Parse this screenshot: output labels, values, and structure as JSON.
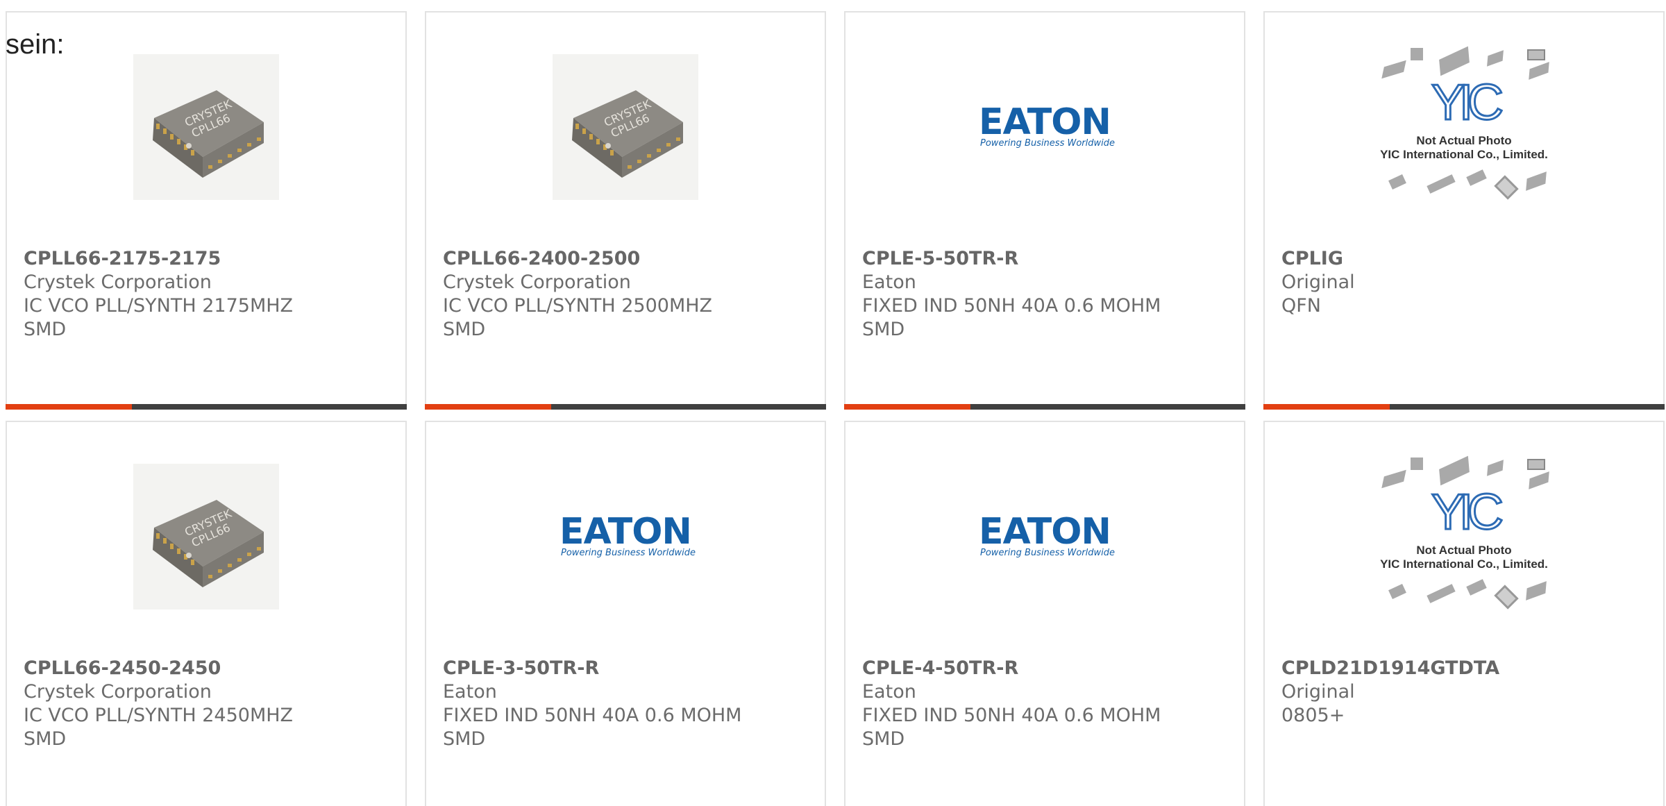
{
  "heading": "sein:",
  "colors": {
    "accent": "#e23f12",
    "bar": "#404040",
    "border": "#e2e2e2",
    "eaton_blue": "#1560a8"
  },
  "products": [
    {
      "part_number": "CPLL66-2175-2175",
      "manufacturer": "Crystek Corporation",
      "description": "IC VCO PLL/SYNTH 2175MHZ",
      "package": "SMD",
      "image": "crystek-chip",
      "chip_text": [
        "CRYSTEK",
        "CPLL66"
      ]
    },
    {
      "part_number": "CPLL66-2400-2500",
      "manufacturer": "Crystek Corporation",
      "description": "IC VCO PLL/SYNTH 2500MHZ",
      "package": "SMD",
      "image": "crystek-chip",
      "chip_text": [
        "CRYSTEK",
        "CPLL66"
      ]
    },
    {
      "part_number": "CPLE-5-50TR-R",
      "manufacturer": "Eaton",
      "description": "FIXED IND 50NH 40A 0.6 MOHM",
      "package": "SMD",
      "image": "eaton-logo",
      "logo_text": "EATON",
      "logo_tagline": "Powering Business Worldwide"
    },
    {
      "part_number": "CPLIG",
      "manufacturer": "Original",
      "description": "QFN",
      "package": "",
      "image": "yic-placeholder",
      "logo_text": "YIC",
      "caption_1": "Not Actual Photo",
      "caption_2": "YIC International Co., Limited."
    },
    {
      "part_number": "CPLL66-2450-2450",
      "manufacturer": "Crystek Corporation",
      "description": "IC VCO PLL/SYNTH 2450MHZ",
      "package": "SMD",
      "image": "crystek-chip",
      "chip_text": [
        "CRYSTEK",
        "CPLL66"
      ]
    },
    {
      "part_number": "CPLE-3-50TR-R",
      "manufacturer": "Eaton",
      "description": "FIXED IND 50NH 40A 0.6 MOHM",
      "package": "SMD",
      "image": "eaton-logo",
      "logo_text": "EATON",
      "logo_tagline": "Powering Business Worldwide"
    },
    {
      "part_number": "CPLE-4-50TR-R",
      "manufacturer": "Eaton",
      "description": "FIXED IND 50NH 40A 0.6 MOHM",
      "package": "SMD",
      "image": "eaton-logo",
      "logo_text": "EATON",
      "logo_tagline": "Powering Business Worldwide"
    },
    {
      "part_number": "CPLD21D1914GTDTA",
      "manufacturer": "Original",
      "description": "0805+",
      "package": "",
      "image": "yic-placeholder",
      "logo_text": "YIC",
      "caption_1": "Not Actual Photo",
      "caption_2": "YIC International Co., Limited."
    }
  ]
}
